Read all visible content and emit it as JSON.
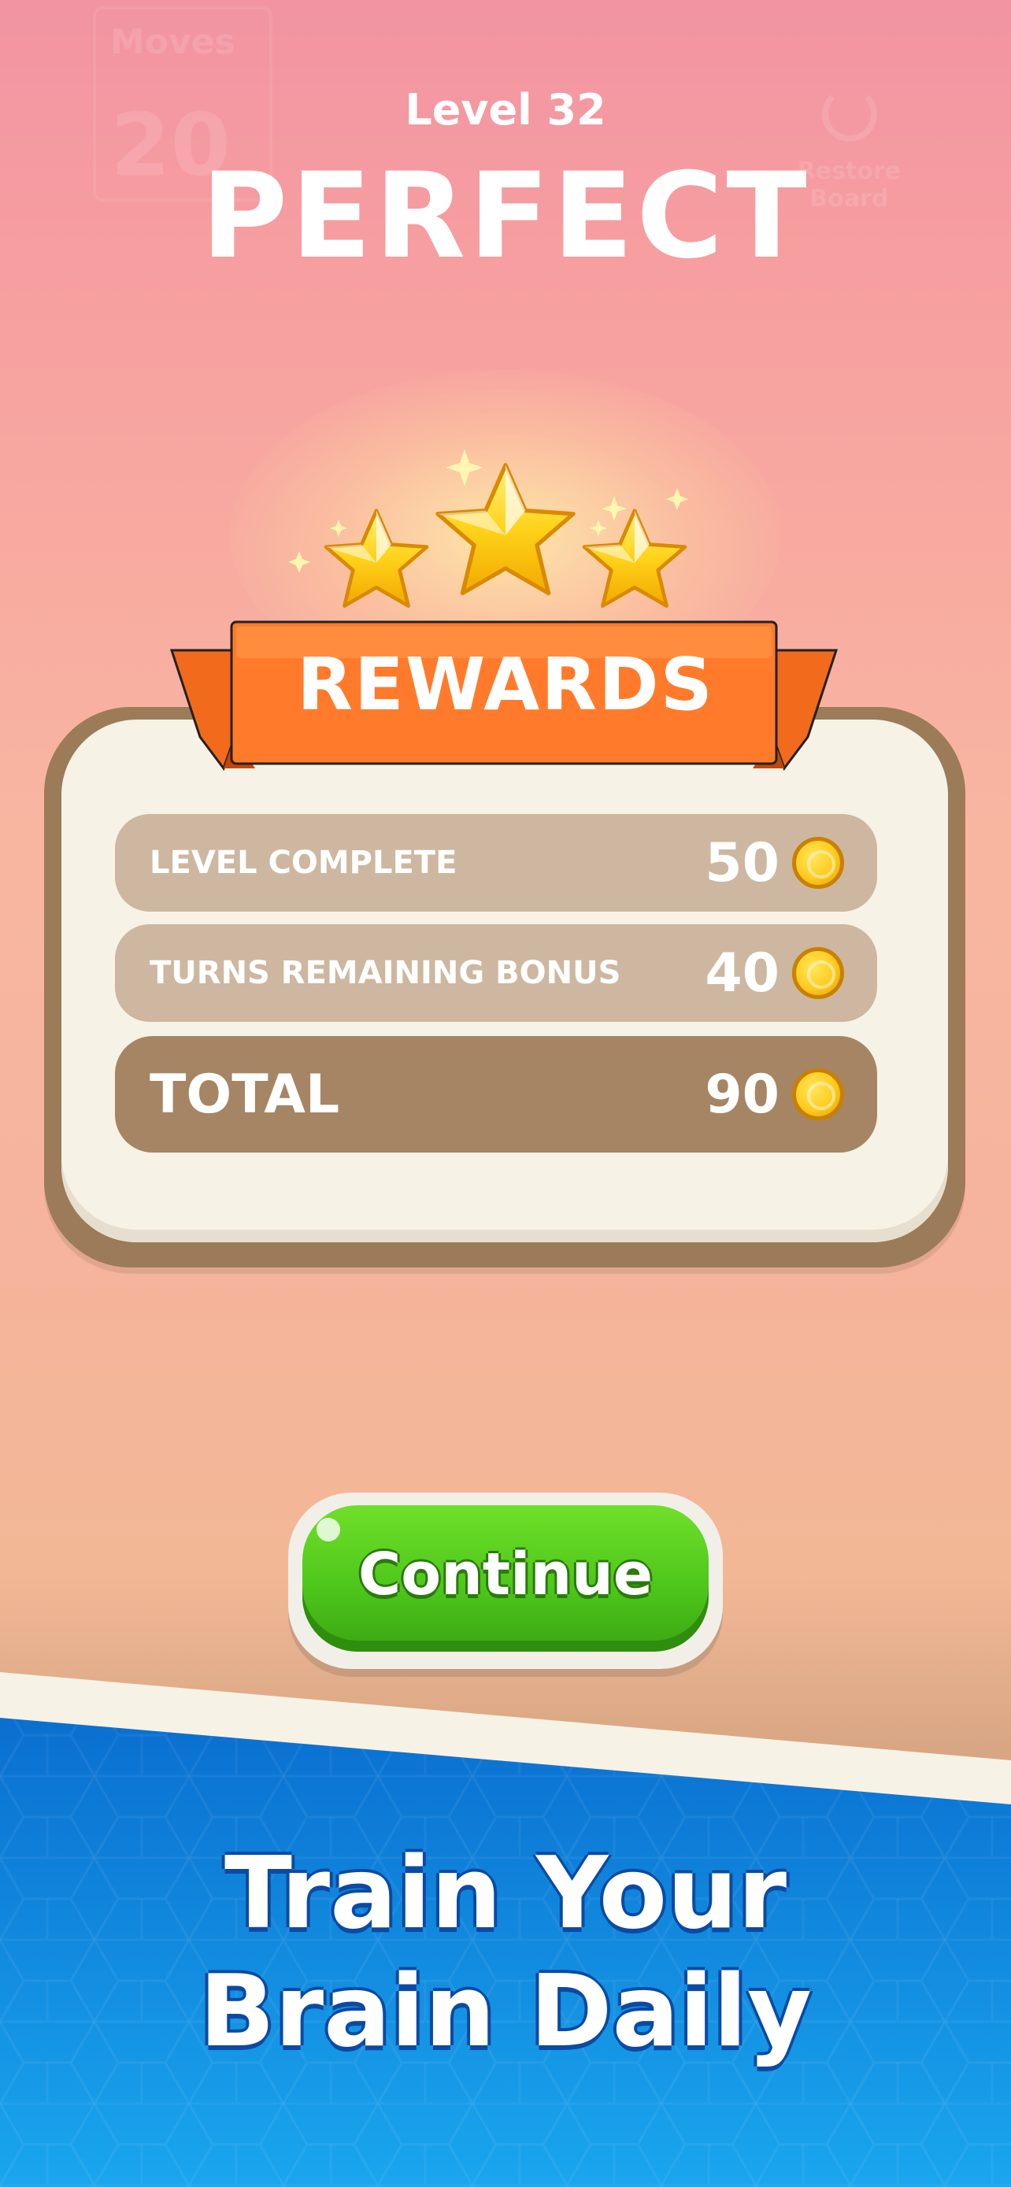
{
  "header": {
    "level": "Level 32",
    "title": "PERFECT"
  },
  "background_ghost": {
    "moves_label": "Moves",
    "moves_value": "20",
    "restore_label": "Restore\nBoard"
  },
  "stars": {
    "earned": 3,
    "total": 3
  },
  "rewards": {
    "title": "REWARDS",
    "rows": [
      {
        "label": "LEVEL COMPLETE",
        "value": "50"
      },
      {
        "label": "TURNS REMAINING BONUS",
        "value": "40"
      }
    ],
    "total": {
      "label": "TOTAL",
      "value": "90"
    }
  },
  "continue_button": {
    "label": "Continue"
  },
  "promo": {
    "line1": "Train Your",
    "line2": "Brain Daily"
  },
  "colors": {
    "button_green": "#4cc41a",
    "ribbon_orange": "#ff7a2e",
    "banner_blue": "#0a72d1",
    "card_brown": "#a58563"
  },
  "icons": {
    "coin": "coin-icon",
    "star": "star-icon",
    "restore": "restore-icon"
  }
}
